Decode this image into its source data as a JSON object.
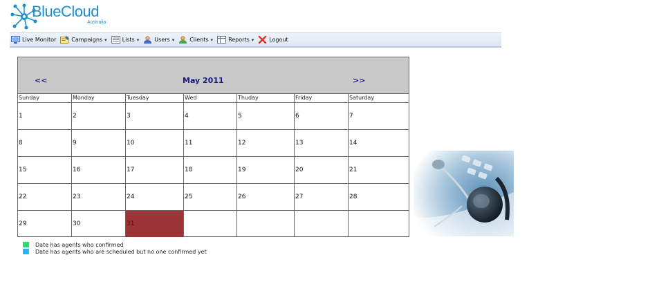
{
  "logo": {
    "name": "BlueCloud",
    "sub": "Australia"
  },
  "menu": [
    {
      "label": "Live Monitor",
      "icon": "monitor-icon",
      "dropdown": false
    },
    {
      "label": "Campaigns",
      "icon": "campaigns-icon",
      "dropdown": true
    },
    {
      "label": "Lists",
      "icon": "list-icon",
      "dropdown": true
    },
    {
      "label": "Users",
      "icon": "user-icon",
      "dropdown": true
    },
    {
      "label": "Clients",
      "icon": "client-icon",
      "dropdown": true
    },
    {
      "label": "Reports",
      "icon": "report-icon",
      "dropdown": true
    },
    {
      "label": "Logout",
      "icon": "logout-icon",
      "dropdown": false
    }
  ],
  "calendar": {
    "prev": "<<",
    "next": ">>",
    "title": "May 2011",
    "days": [
      "Sunday",
      "Monday",
      "Tuesday",
      "Wed",
      "Thuday",
      "Friday",
      "Saturday"
    ],
    "weeks": [
      [
        "1",
        "2",
        "3",
        "4",
        "5",
        "6",
        "7"
      ],
      [
        "8",
        "9",
        "10",
        "11",
        "12",
        "13",
        "14"
      ],
      [
        "15",
        "16",
        "17",
        "18",
        "19",
        "20",
        "21"
      ],
      [
        "22",
        "23",
        "24",
        "25",
        "26",
        "27",
        "28"
      ],
      [
        "29",
        "30",
        "31",
        "",
        "",
        "",
        ""
      ]
    ],
    "highlight_day": "31",
    "highlight_color": "#9b3434"
  },
  "legend": [
    {
      "color": "#22dd66",
      "text": "Date has agents who confirmed"
    },
    {
      "color": "#2ab8f0",
      "text": "Date has agents who are scheduled but no one confirmed yet"
    }
  ]
}
